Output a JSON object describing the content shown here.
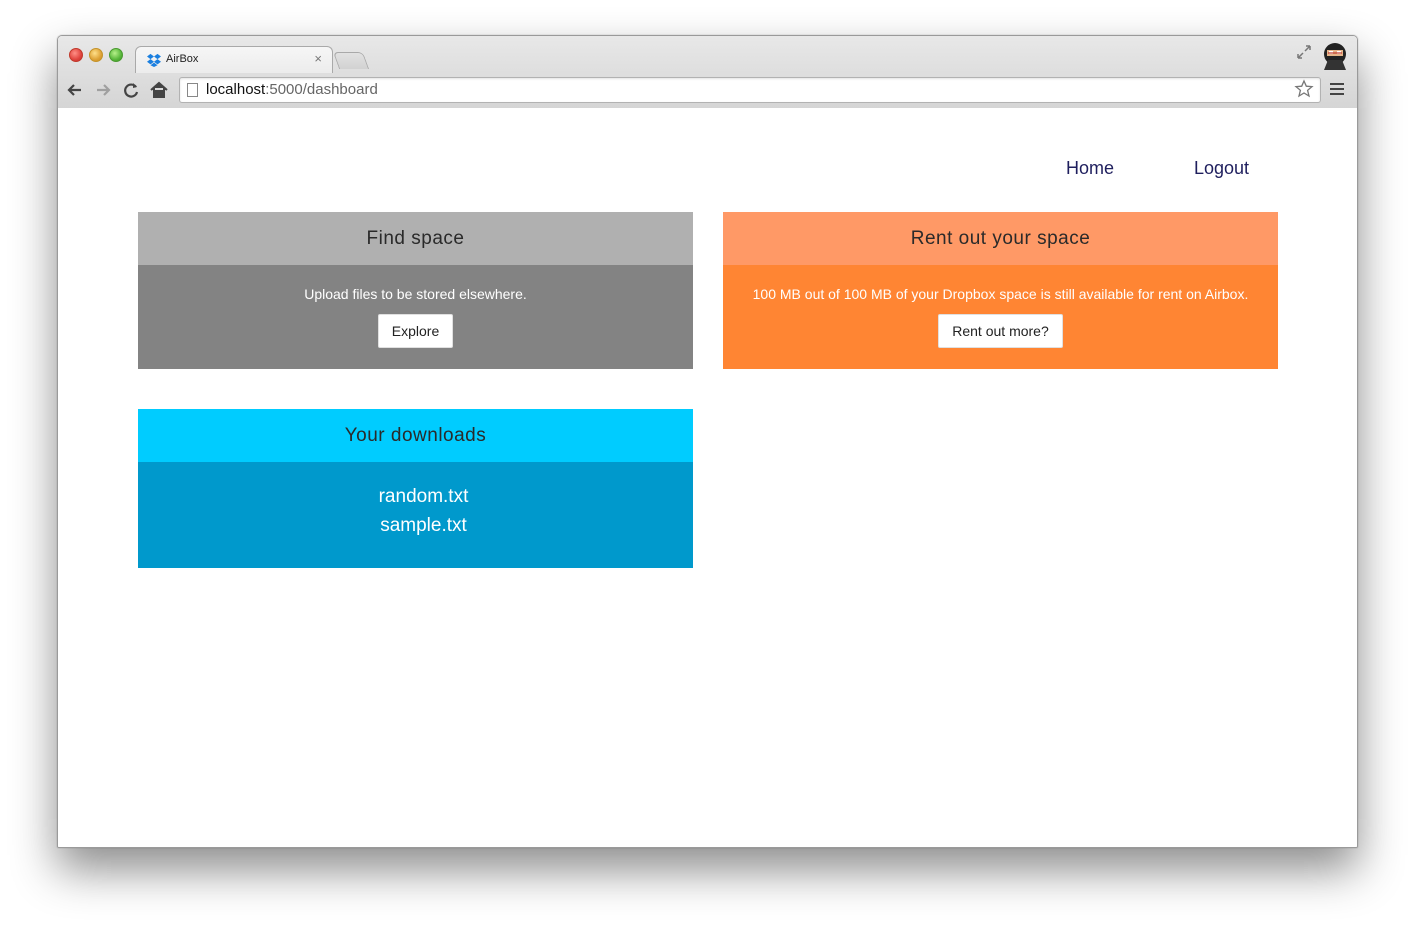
{
  "browser": {
    "tab_title": "AirBox",
    "tab_close": "×",
    "url_host": "localhost",
    "url_rest": ":5000/dashboard"
  },
  "nav": {
    "home": "Home",
    "logout": "Logout"
  },
  "panels": {
    "find": {
      "title": "Find space",
      "text": "Upload files to be stored elsewhere.",
      "button": "Explore"
    },
    "rent": {
      "title": "Rent out your space",
      "text": "100 MB out of 100 MB of your Dropbox space is still available for rent on Airbox.",
      "button": "Rent out more?"
    },
    "downloads": {
      "title": "Your downloads",
      "files": [
        "random.txt",
        "sample.txt"
      ]
    }
  },
  "colors": {
    "find_head": "#b0b0b0",
    "find_body": "#838383",
    "rent_head": "#ff9966",
    "rent_body": "#ff8533",
    "downloads_head": "#00ccff",
    "downloads_body": "#0099cc",
    "nav_link": "#1f1f5e"
  },
  "icons": {
    "tab": "dropbox-icon",
    "back": "back-arrow-icon",
    "forward": "forward-arrow-icon",
    "reload": "reload-icon",
    "home": "home-icon",
    "page": "page-icon",
    "star": "star-icon",
    "menu": "menu-icon",
    "fullscreen": "fullscreen-icon",
    "profile": "profile-avatar-icon"
  }
}
